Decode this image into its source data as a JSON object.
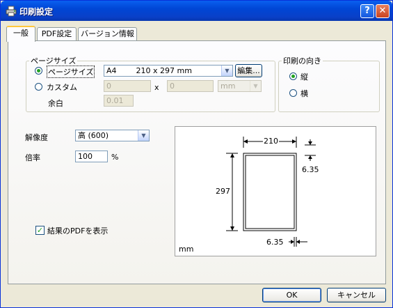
{
  "window": {
    "title": "印刷設定",
    "help_label": "?",
    "close_label": "✕"
  },
  "tabs": [
    {
      "label": "一般",
      "active": true
    },
    {
      "label": "PDF設定",
      "active": false
    },
    {
      "label": "バージョン情報",
      "active": false
    }
  ],
  "page_size": {
    "group_label": "ページサイズ",
    "option_size_label": "ページサイズ",
    "option_custom_label": "カスタム",
    "size_value": "A4        210 x 297 mm",
    "edit_label": "編集...",
    "custom_width": "0",
    "custom_times": "x",
    "custom_height": "0",
    "custom_unit": "mm",
    "margin_label": "余白",
    "margin_value": "0.01"
  },
  "orientation": {
    "group_label": "印刷の向き",
    "portrait_label": "縦",
    "landscape_label": "横"
  },
  "resolution": {
    "label": "解像度",
    "value": "高 (600)"
  },
  "scale": {
    "label": "倍率",
    "value": "100",
    "unit": "%"
  },
  "show_pdf": {
    "label": "結果のPDFを表示",
    "checked": true
  },
  "preview": {
    "width": "210",
    "height": "297",
    "margin_top": "6.35",
    "margin_bottom": "6.35",
    "unit": "mm"
  },
  "buttons": {
    "ok": "OK",
    "cancel": "キャンセル"
  },
  "icons": {
    "combo_arrow": "▼",
    "check": "✓"
  }
}
